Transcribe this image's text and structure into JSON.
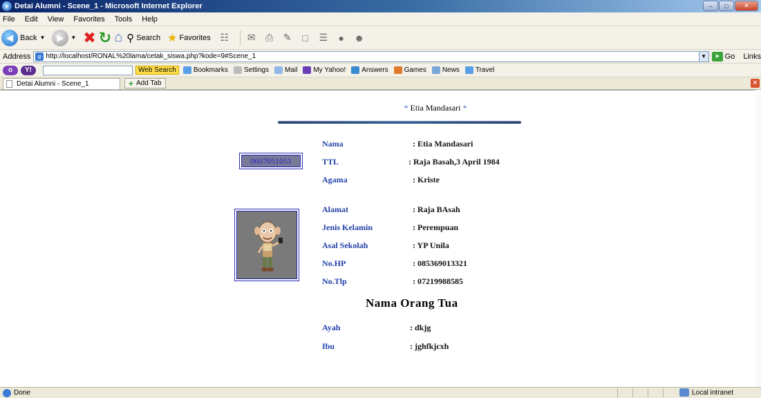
{
  "window": {
    "title": "Detai Alumni - Scene_1 - Microsoft Internet Explorer",
    "colors": {
      "titlebar": "#0a246a",
      "label": "#1f3fa8",
      "divider": "#2d5590"
    }
  },
  "menu": [
    "File",
    "Edit",
    "View",
    "Favorites",
    "Tools",
    "Help"
  ],
  "toolbar": {
    "back_label": "Back",
    "search_label": "Search",
    "favorites_label": "Favorites"
  },
  "address": {
    "label": "Address",
    "url": "http://localhost/RONAL%20lama/cetak_siswa.php?kode=9#Scene_1",
    "go_label": "Go",
    "links_label": "Links"
  },
  "yahoo": {
    "web_search_label": "Web Search",
    "items": [
      "Bookmarks",
      "Settings",
      "Mail",
      "My Yahoo!",
      "Answers",
      "Games",
      "News",
      "Travel"
    ]
  },
  "tabs": {
    "active_tab": "Detai Alumni - Scene_1",
    "add_tab_label": "Add Tab"
  },
  "page": {
    "heading_name": "Etia Mandasari",
    "star": "*",
    "nis": "0607051051",
    "photo_icon": "cartoon-character-icon",
    "fields_top": [
      {
        "label": "Nama",
        "value": ": Etia Mandasari"
      },
      {
        "label": "TTL",
        "value": ": Raja Basah,3 April 1984"
      },
      {
        "label": "Agama",
        "value": ": Kriste"
      }
    ],
    "fields_mid": [
      {
        "label": "Alamat",
        "value": ": Raja BAsah"
      },
      {
        "label": "Jenis Kelamin",
        "value": ": Perempuan"
      },
      {
        "label": "Asal Sekolah",
        "value": ": YP Unila"
      },
      {
        "label": "No.HP",
        "value": ": 085369013321"
      },
      {
        "label": "No.Tlp",
        "value": ": 07219988585"
      }
    ],
    "section_title": "Nama Orang Tua",
    "fields_parents": [
      {
        "label": "Ayah",
        "value": ": dkjg"
      },
      {
        "label": "Ibu",
        "value": ": jghfkjcxh"
      }
    ]
  },
  "status": {
    "left": "Done",
    "right": "Local intranet"
  }
}
